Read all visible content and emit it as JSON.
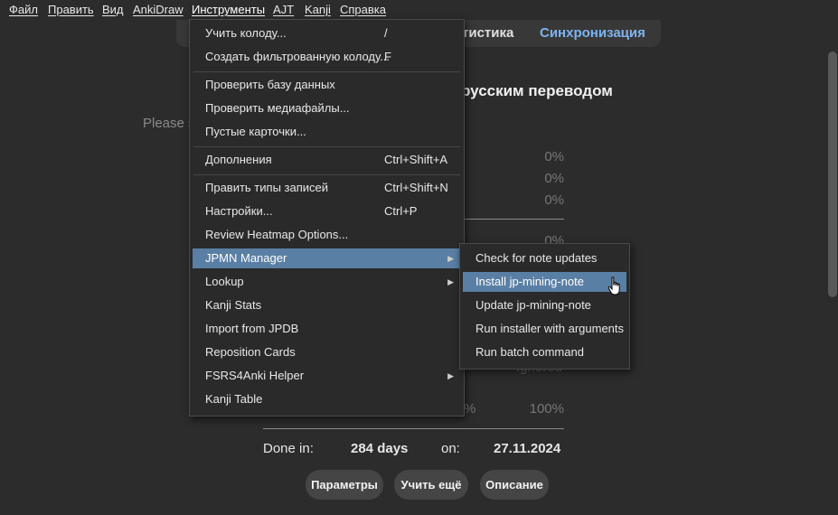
{
  "menubar": {
    "items": [
      "Файл",
      "Править",
      "Вид",
      "AnkiDraw",
      "Инструменты",
      "AJT",
      "Kanji",
      "Справка"
    ]
  },
  "topbar": {
    "stats_tab": "тистика",
    "sync_tab": "Синхронизация"
  },
  "main": {
    "deck_title_partial": "русским переводом",
    "prompt_partial": "Please s",
    "percents": [
      "0%",
      "0%",
      "0%",
      "0%"
    ],
    "ignored": "Ignored",
    "pct_partial": "%",
    "pct_total": "100%",
    "done_in_label": "Done in:",
    "done_in_value": "284 days",
    "on_label": "on:",
    "on_value": "27.11.2024"
  },
  "buttons": {
    "options": "Параметры",
    "study_more": "Учить ещё",
    "description": "Описание"
  },
  "tools_menu": {
    "items": [
      {
        "label": "Учить колоду...",
        "shortcut": "/"
      },
      {
        "label": "Создать фильтрованную колоду...",
        "shortcut": "F"
      },
      {
        "label": "Проверить базу данных",
        "shortcut": ""
      },
      {
        "label": "Проверить медиафайлы...",
        "shortcut": ""
      },
      {
        "label": "Пустые карточки...",
        "shortcut": ""
      },
      {
        "label": "Дополнения",
        "shortcut": "Ctrl+Shift+A"
      },
      {
        "label": "Править типы записей",
        "shortcut": "Ctrl+Shift+N"
      },
      {
        "label": "Настройки...",
        "shortcut": "Ctrl+P"
      },
      {
        "label": "Review Heatmap Options...",
        "shortcut": ""
      },
      {
        "label": "JPMN Manager",
        "shortcut": ""
      },
      {
        "label": "Lookup",
        "shortcut": ""
      },
      {
        "label": "Kanji Stats",
        "shortcut": ""
      },
      {
        "label": "Import from JPDB",
        "shortcut": ""
      },
      {
        "label": "Reposition Cards",
        "shortcut": ""
      },
      {
        "label": "FSRS4Anki Helper",
        "shortcut": ""
      },
      {
        "label": "Kanji Table",
        "shortcut": ""
      }
    ]
  },
  "jpmn_submenu": {
    "items": [
      "Check for note updates",
      "Install jp-mining-note",
      "Update jp-mining-note",
      "Run installer with arguments",
      "Run batch command"
    ]
  },
  "colors": {
    "highlight": "#5a7fa4",
    "sync_tab": "#7fb3ef",
    "background": "#2c2c2c"
  },
  "icons": {
    "submenu": "triangle-right-icon",
    "cursor": "hand-pointer-icon"
  }
}
